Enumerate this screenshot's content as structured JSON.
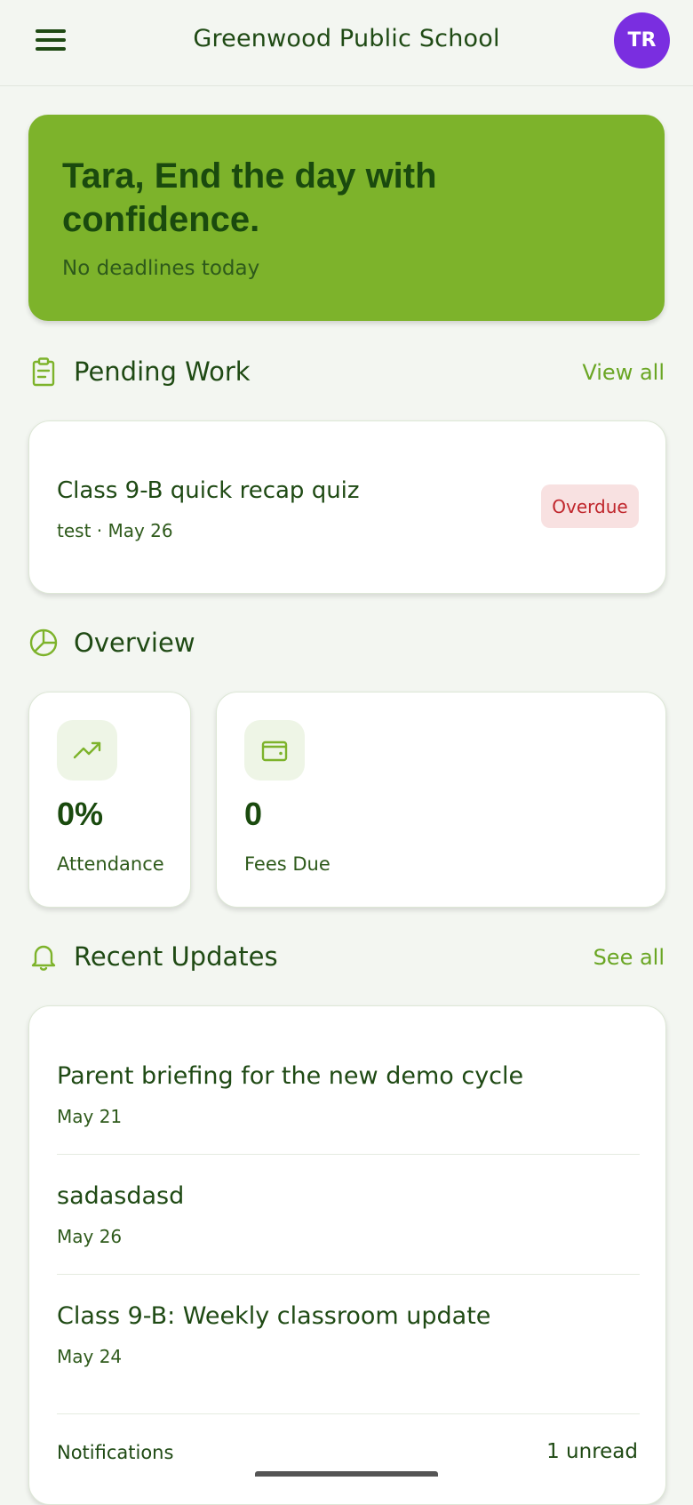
{
  "header": {
    "title": "Greenwood Public School",
    "avatar_initials": "TR",
    "avatar_color": "#7a2ee0",
    "menu_icon": "hamburger-menu-icon"
  },
  "hero": {
    "title": "Tara, End the day with confidence.",
    "subtitle": "No deadlines today",
    "color": "#7db32b"
  },
  "pending": {
    "section_title": "Pending Work",
    "icon": "clipboard-icon",
    "view_all_label": "View all",
    "items": [
      {
        "title": "Class 9-B quick recap quiz",
        "meta": "test · May 26",
        "status": "Overdue"
      }
    ]
  },
  "overview": {
    "section_title": "Overview",
    "icon": "pie-chart-icon",
    "stats": [
      {
        "value": "0%",
        "label": "Attendance",
        "icon": "trending-up-icon"
      },
      {
        "value": "0",
        "label": "Fees Due",
        "icon": "wallet-icon"
      }
    ]
  },
  "updates": {
    "section_title": "Recent Updates",
    "icon": "bell-icon",
    "see_all_label": "See all",
    "items": [
      {
        "title": "Parent briefing for the new demo cycle",
        "date": "May 21"
      },
      {
        "title": "sadasdasd",
        "date": "May 26"
      },
      {
        "title": "Class 9-B: Weekly classroom update",
        "date": "May 24"
      }
    ],
    "notifications_label": "Notifications",
    "notifications_count": "1 unread"
  }
}
